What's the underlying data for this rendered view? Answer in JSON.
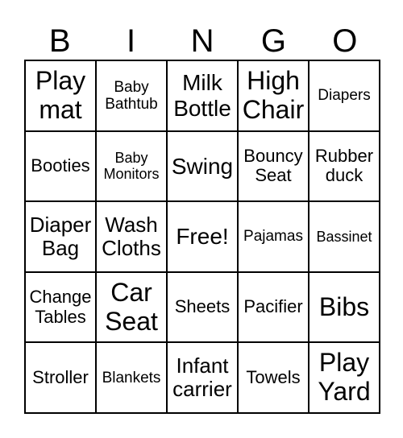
{
  "header": [
    "B",
    "I",
    "N",
    "G",
    "O"
  ],
  "cells": [
    "Play mat",
    "Baby Bathtub",
    "Milk Bottle",
    "High Chair",
    "Diapers",
    "Booties",
    "Baby Monitors",
    "Swing",
    "Bouncy Seat",
    "Rubber duck",
    "Diaper Bag",
    "Wash Cloths",
    "Free!",
    "Pajamas",
    "Bassinet",
    "Change Tables",
    "Car Seat",
    "Sheets",
    "Pacifier",
    "Bibs",
    "Stroller",
    "Blankets",
    "Infant carrier",
    "Towels",
    "Play Yard"
  ]
}
